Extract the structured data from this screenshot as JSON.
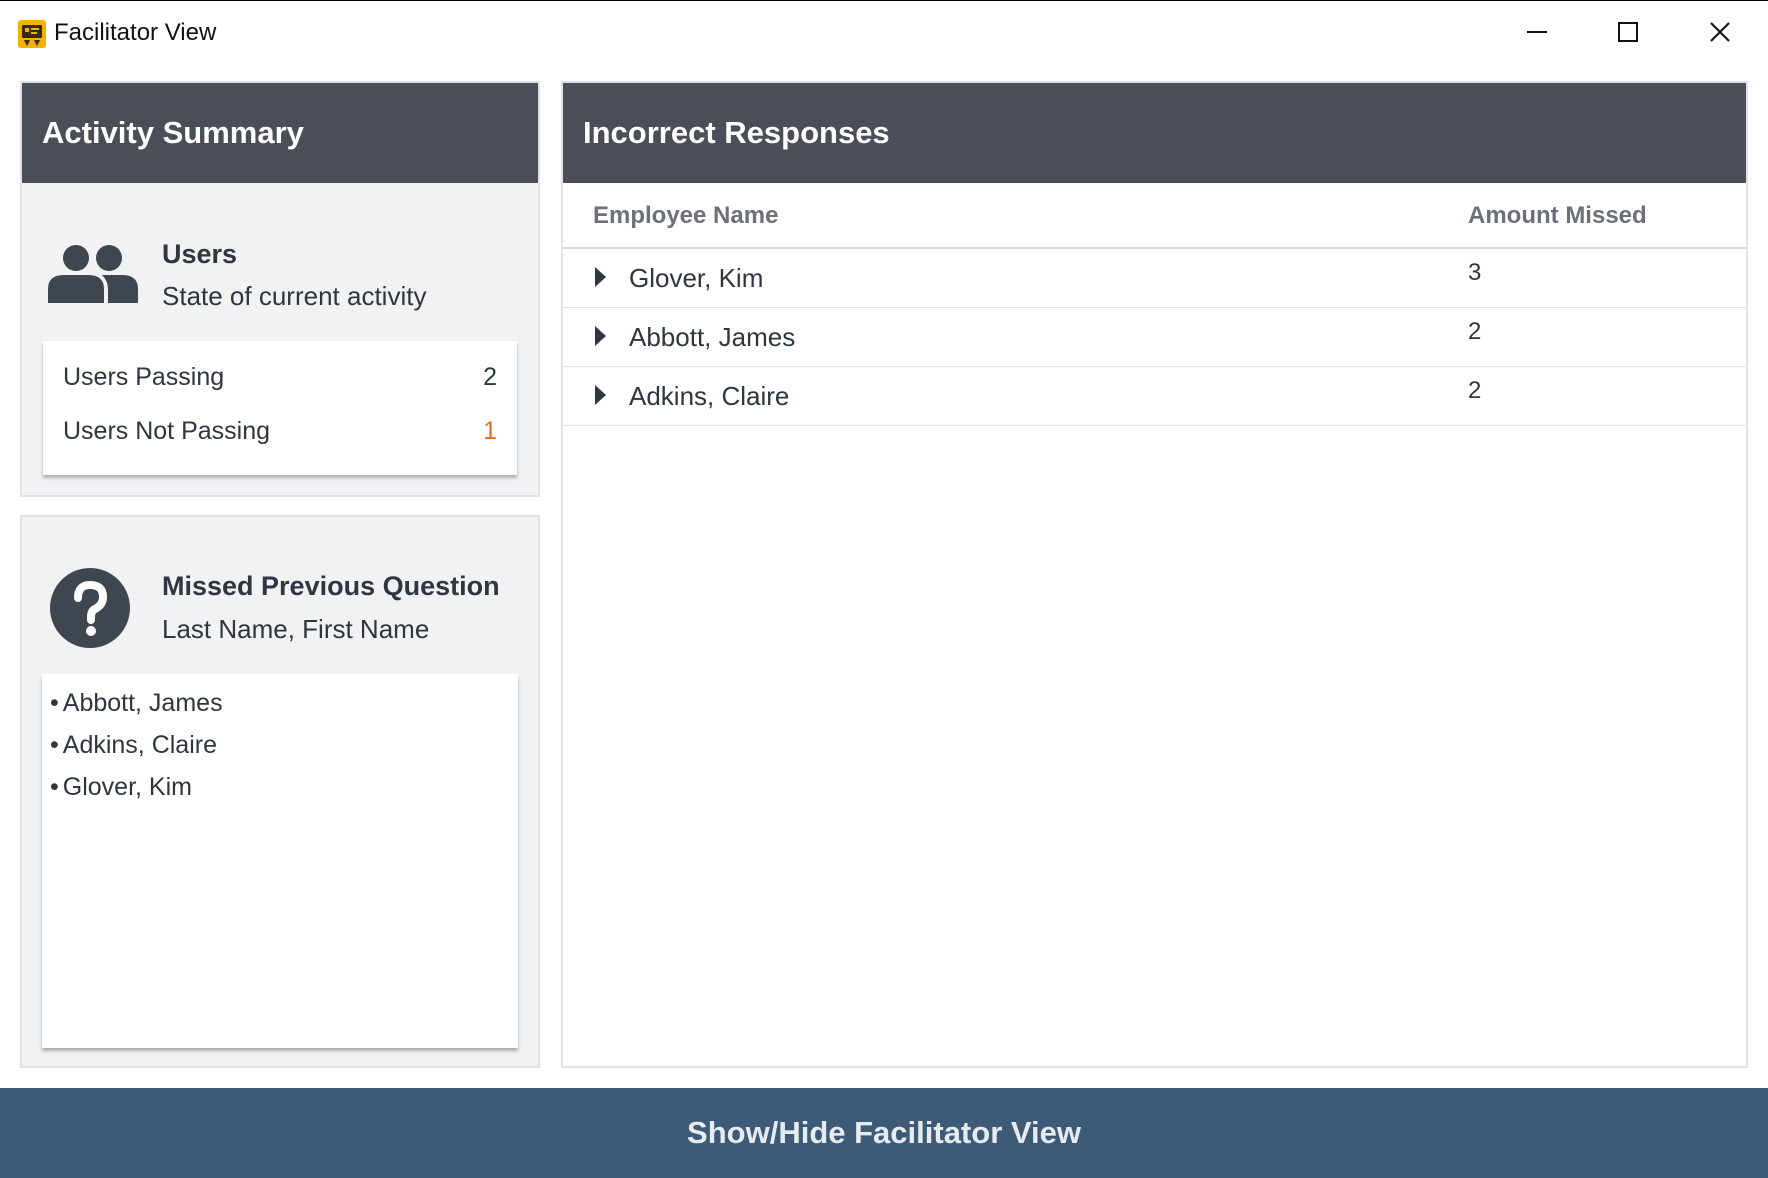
{
  "window": {
    "title": "Facilitator View",
    "controls": {
      "minimize": "minimize-icon",
      "maximize": "maximize-icon",
      "close": "close-icon"
    }
  },
  "activity_summary": {
    "header": "Activity Summary",
    "users_title": "Users",
    "users_subtitle": "State of current activity",
    "stats": [
      {
        "label": "Users Passing",
        "value": "2",
        "color": "#2f3640"
      },
      {
        "label": "Users Not Passing",
        "value": "1",
        "color": "#e8682a"
      }
    ]
  },
  "missed_previous": {
    "title": "Missed Previous Question",
    "subtitle": "Last Name, First Name",
    "bullet": "•",
    "names": [
      "Abbott, James",
      "Adkins, Claire",
      "Glover, Kim"
    ]
  },
  "incorrect_responses": {
    "header": "Incorrect Responses",
    "columns": [
      "Employee Name",
      "Amount Missed"
    ],
    "rows": [
      {
        "name": "Glover, Kim",
        "amount": "3"
      },
      {
        "name": "Abbott, James",
        "amount": "2"
      },
      {
        "name": "Adkins, Claire",
        "amount": "2"
      }
    ]
  },
  "footer": {
    "toggle_label": "Show/Hide Facilitator View"
  },
  "colors": {
    "header_bg": "#4a4f57",
    "footer_bg": "#3d5a76",
    "panel_bg": "#f1f2f3",
    "not_passing_accent": "#e8682a",
    "app_icon": "#f0b400"
  }
}
